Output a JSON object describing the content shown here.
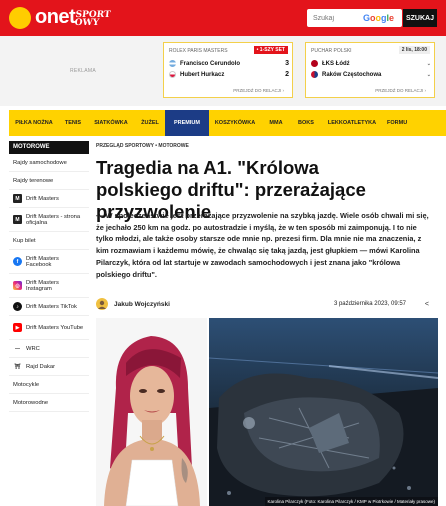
{
  "header": {
    "logo_text": "onet",
    "section_logo_line1": "SPORT",
    "section_logo_line2": "OWY",
    "search_placeholder": "Szukaj",
    "search_engine": "Google",
    "search_button": "SZUKAJ",
    "colors": {
      "brand_red": "#e3141b",
      "logo_dot": "#ffcd00"
    }
  },
  "ad": {
    "label": "REKLAMA"
  },
  "scorecards": [
    {
      "competition": "ROLEX PARIS MASTERS",
      "badge": "• 1-SZY SET",
      "players": [
        {
          "name": "Francisco Cerundolo",
          "score": "3",
          "flag_color": "#74acdf"
        },
        {
          "name": "Hubert Hurkacz",
          "score": "2",
          "flag_color": "#dc143c"
        }
      ],
      "link": "PRZEJDŹ DO RELACJI ›"
    },
    {
      "competition": "PUCHAR POLSKI",
      "badge": "2 lis, 18:00",
      "teams": [
        {
          "name": "ŁKS Łódź",
          "chevron": "⌄",
          "crest_color": "#b3001b"
        },
        {
          "name": "Raków Częstochowa",
          "chevron": "⌄",
          "crest_color": "#c8102e"
        }
      ],
      "link": "PRZEJDŹ DO RELACJI ›"
    }
  ],
  "nav": {
    "items": [
      "PIŁKA NOŻNA",
      "TENIS",
      "SIATKÓWKA",
      "ŻUŻEL",
      "PREMIUM",
      "KOSZYKÓWKA",
      "MMA",
      "BOKS",
      "LEKKOATLETYKA",
      "FORMU"
    ],
    "active_index": 4,
    "colors": {
      "bar": "#ffd200",
      "active": "#1c3c86"
    }
  },
  "sidebar": {
    "heading": "MOTOROWE",
    "items": [
      {
        "label": "Rajdy samochodowe",
        "icon": ""
      },
      {
        "label": "Rajdy terenowe",
        "icon": ""
      },
      {
        "label": "Drift Masters",
        "icon": "drift-masters-logo-icon"
      },
      {
        "label": "Drift Masters - strona oficjalna",
        "icon": "drift-masters-logo-icon"
      },
      {
        "label": "Kup bilet",
        "icon": ""
      },
      {
        "label": "Drift Masters Facebook",
        "icon": "facebook-icon"
      },
      {
        "label": "Drift Masters Instagram",
        "icon": "instagram-icon"
      },
      {
        "label": "Drift Masters TikTok",
        "icon": "tiktok-icon"
      },
      {
        "label": "Drift Masters YouTube",
        "icon": "youtube-icon"
      },
      {
        "label": "WRC",
        "icon": "wrc-logo-icon"
      },
      {
        "label": "Rajd Dakar",
        "icon": "dakar-logo-icon"
      },
      {
        "label": "Motocykle",
        "icon": ""
      },
      {
        "label": "Motorowodne",
        "icon": ""
      }
    ]
  },
  "article": {
    "breadcrumb": "PRZEGLĄD SPORTOWY • MOTOROWE",
    "title": "Tragedia na A1. \"Królowa polskiego driftu\": przerażające przyzwolenie",
    "lead": "— W społeczeństwie jest przerażające przyzwolenie na szybką jazdę. Wiele osób chwali mi się, że jechało 250 km na godz. po autostradzie i myślą, że w ten sposób mi zaimponują. I to nie tylko młodzi, ale także osoby starsze ode mnie np. prezesi firm. Dla mnie nie ma znaczenia, z kim rozmawiam i każdemu mówię, że chwaląc się taką jazdą, jest głupkiem — mówi Karolina Pilarczyk, która od lat startuje w zawodach samochodowych i jest znana jako \"królowa polskiego driftu\".",
    "author": "Jakub Wojczyński",
    "date": "3 października 2023, 09:57",
    "share_icon": "share-icon",
    "photo_caption": "Karolina Pilarczyk (Foto: Karolina Pilarczyk / KMP w Piotrkowie / Materiały prasowe)"
  }
}
